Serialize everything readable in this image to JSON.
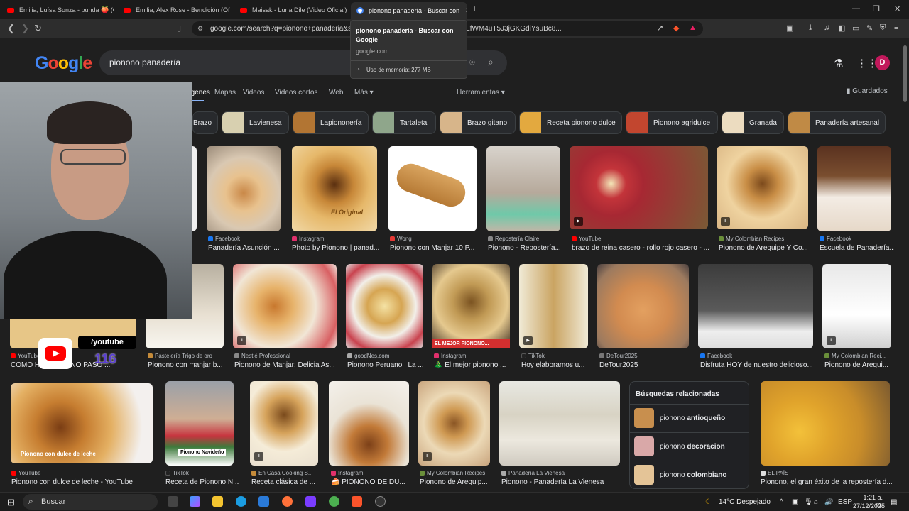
{
  "tabs": [
    {
      "label": "Emilia, Luísa Sonza - bunda 🍑 (Offic",
      "active": false
    },
    {
      "label": "Emilia, Alex Rose - Bendición (Oficial",
      "active": false
    },
    {
      "label": "Maisak - Luna Dile (Video Oficial) - Y",
      "active": false
    },
    {
      "label": "pionono panadería - Buscar con",
      "active": true
    }
  ],
  "toolbar": {
    "url": "google.com/search?q=pionono+panaderia&sca   =1920&bih=959&sxsrf=AE3TifNirEfWM4uT5J3jGKGdiYsuBc8..."
  },
  "hover_card": {
    "title": "pionono panadería - Buscar con Google",
    "domain": "google.com",
    "memory": "Uso de memoria: 277 MB"
  },
  "google": {
    "logo": "Google",
    "query": "pionono panadería",
    "avatar_letter": "D",
    "nav_tabs": [
      "Imágenes",
      "Mapas",
      "Videos",
      "Videos cortos",
      "Web",
      "Más ▾"
    ],
    "tools": "Herramientas ▾",
    "saved": "Guardados"
  },
  "chips": [
    "Brazo",
    "Lavienesa",
    "Lapiononería",
    "Tartaleta",
    "Brazo gitano",
    "Receta pionono dulce",
    "Pionono agridulce",
    "Granada",
    "Panadería artesanal"
  ],
  "results_row1": [
    {
      "source": "Facebook",
      "caption": "Panadería Asunción ..."
    },
    {
      "source": "Instagram",
      "caption": "Photo by Pionono | panad..."
    },
    {
      "source": "Wong",
      "caption": "Pionono con Manjar 10 P..."
    },
    {
      "source": "Repostería Claire",
      "caption": "Pionono - Repostería..."
    },
    {
      "source": "YouTube",
      "caption": "brazo de reina casero - rollo rojo casero - ..."
    },
    {
      "source": "My Colombian Recipes",
      "caption": "Pionono de Arequipe Y Co..."
    },
    {
      "source": "Facebook",
      "caption": "Escuela de Panadería..."
    }
  ],
  "results_row2": [
    {
      "source": "YouTube",
      "caption": "CÓMO H...   PIONONO PASO ..."
    },
    {
      "source": "Pastelería Trigo de oro",
      "caption": "Pionono con manjar b..."
    },
    {
      "source": "Nestlé Professional",
      "caption": "Pionono de Manjar: Delicia As..."
    },
    {
      "source": "goodNes.com",
      "caption": "Pionono Peruano | La ..."
    },
    {
      "source": "Instagram",
      "caption": "🎄 El mejor pionono ..."
    },
    {
      "source": "TikTok",
      "caption": "Hoy elaboramos u..."
    },
    {
      "source": "DeTour2025",
      "caption": "DeTour2025"
    },
    {
      "source": "Facebook",
      "caption": "Disfruta HOY de nuestro delicioso..."
    },
    {
      "source": "My Colombian Reci...",
      "caption": "Pionono de Arequi..."
    }
  ],
  "results_row3": [
    {
      "source": "YouTube",
      "caption": "Pionono con dulce de leche - YouTube"
    },
    {
      "source": "TikTok",
      "caption": "Receta de Pionono N..."
    },
    {
      "source": "En Casa Cooking S...",
      "caption": "Receta clásica de ..."
    },
    {
      "source": "Instagram",
      "caption": "🍰 PIONONO DE DU..."
    },
    {
      "source": "My Colombian Recipes",
      "caption": "Pionono de Arequip..."
    },
    {
      "source": "Panadería La Vienesa",
      "caption": "Pionono - Panadería La Vienesa"
    },
    {
      "source": "EL PAÍS",
      "caption": "Pionono, el gran éxito de la repostería d..."
    }
  ],
  "image_overlays": {
    "r2_badge": "EL MEJOR PIONONO...",
    "r3_dulce": "Pionono con dulce de leche",
    "r3_navideno": "Pionono Navideño",
    "r1_original": "El Original"
  },
  "related": {
    "heading": "Búsquedas relacionadas",
    "items": [
      {
        "prefix": "pionono ",
        "bold": "antioqueño"
      },
      {
        "prefix": "pionono ",
        "bold": "decoracion"
      },
      {
        "prefix": "pionono ",
        "bold": "colombiano"
      }
    ]
  },
  "webcam": {
    "handle": "/youtube",
    "count": "116"
  },
  "taskbar": {
    "search": "Buscar",
    "weather": "14°C  Despejado",
    "lang": "ESP",
    "time": "1:21 a. m.",
    "date": "27/12/2025"
  },
  "colors": {
    "background": "#1f1f1f",
    "link_accent": "#8ab4f8",
    "avatar": "#c2185b"
  }
}
